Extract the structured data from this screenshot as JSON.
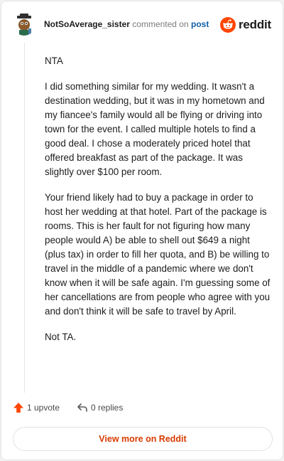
{
  "header": {
    "username": "NotSoAverage_sister",
    "commented_on": "commented on",
    "post_link": "post",
    "brand": "reddit",
    "brand_color": "#ff4500"
  },
  "comment": {
    "paragraphs": [
      "NTA",
      "I did something similar for my wedding. It wasn't a destination wedding, but it was in my hometown and my fiancee's family would all be flying or driving into town for the event. I called multiple hotels to find a good deal. I chose a moderately priced hotel that offered breakfast as part of the package. It was slightly over $100 per room.",
      "Your friend likely had to buy a package in order to host her wedding at that hotel. Part of the package is rooms. This is her fault for not figuring how many people would A) be able to shell out $649 a night (plus tax) in order to fill her quota, and B) be willing to travel in the middle of a pandemic where we don't know when it will be safe again. I'm guessing some of her cancellations are from people who agree with you and don't think it will be safe to travel by April.",
      "Not TA."
    ]
  },
  "footer": {
    "upvote_label": "1 upvote",
    "replies_label": "0 replies",
    "upvote_icon": "upvote-arrow-icon",
    "reply_icon": "reply-arrow-icon"
  },
  "cta": {
    "label": "View more on Reddit",
    "color": "#d93a00"
  }
}
